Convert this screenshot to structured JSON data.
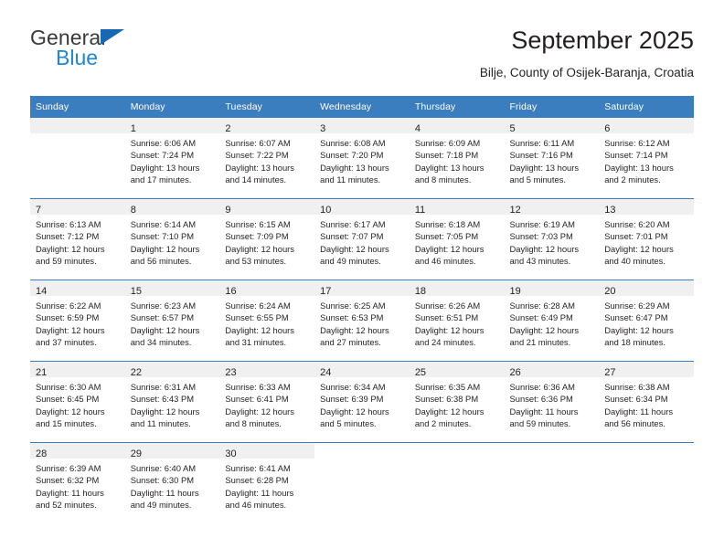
{
  "brand": {
    "name_top": "General",
    "name_bottom": "Blue",
    "triangle_color": "#1668b3",
    "blue_color": "#1f86d4"
  },
  "header": {
    "month_title": "September 2025",
    "location": "Bilje, County of Osijek-Baranja, Croatia"
  },
  "theme": {
    "header_row_color": "#3a7ebf",
    "daynum_band_color": "#f0f0f0",
    "text_color": "#231f20"
  },
  "calendar": {
    "weekday_headers": [
      "Sunday",
      "Monday",
      "Tuesday",
      "Wednesday",
      "Thursday",
      "Friday",
      "Saturday"
    ],
    "weeks": [
      [
        {
          "day": "",
          "lines": []
        },
        {
          "day": "1",
          "lines": [
            "Sunrise: 6:06 AM",
            "Sunset: 7:24 PM",
            "Daylight: 13 hours",
            "and 17 minutes."
          ]
        },
        {
          "day": "2",
          "lines": [
            "Sunrise: 6:07 AM",
            "Sunset: 7:22 PM",
            "Daylight: 13 hours",
            "and 14 minutes."
          ]
        },
        {
          "day": "3",
          "lines": [
            "Sunrise: 6:08 AM",
            "Sunset: 7:20 PM",
            "Daylight: 13 hours",
            "and 11 minutes."
          ]
        },
        {
          "day": "4",
          "lines": [
            "Sunrise: 6:09 AM",
            "Sunset: 7:18 PM",
            "Daylight: 13 hours",
            "and 8 minutes."
          ]
        },
        {
          "day": "5",
          "lines": [
            "Sunrise: 6:11 AM",
            "Sunset: 7:16 PM",
            "Daylight: 13 hours",
            "and 5 minutes."
          ]
        },
        {
          "day": "6",
          "lines": [
            "Sunrise: 6:12 AM",
            "Sunset: 7:14 PM",
            "Daylight: 13 hours",
            "and 2 minutes."
          ]
        }
      ],
      [
        {
          "day": "7",
          "lines": [
            "Sunrise: 6:13 AM",
            "Sunset: 7:12 PM",
            "Daylight: 12 hours",
            "and 59 minutes."
          ]
        },
        {
          "day": "8",
          "lines": [
            "Sunrise: 6:14 AM",
            "Sunset: 7:10 PM",
            "Daylight: 12 hours",
            "and 56 minutes."
          ]
        },
        {
          "day": "9",
          "lines": [
            "Sunrise: 6:15 AM",
            "Sunset: 7:09 PM",
            "Daylight: 12 hours",
            "and 53 minutes."
          ]
        },
        {
          "day": "10",
          "lines": [
            "Sunrise: 6:17 AM",
            "Sunset: 7:07 PM",
            "Daylight: 12 hours",
            "and 49 minutes."
          ]
        },
        {
          "day": "11",
          "lines": [
            "Sunrise: 6:18 AM",
            "Sunset: 7:05 PM",
            "Daylight: 12 hours",
            "and 46 minutes."
          ]
        },
        {
          "day": "12",
          "lines": [
            "Sunrise: 6:19 AM",
            "Sunset: 7:03 PM",
            "Daylight: 12 hours",
            "and 43 minutes."
          ]
        },
        {
          "day": "13",
          "lines": [
            "Sunrise: 6:20 AM",
            "Sunset: 7:01 PM",
            "Daylight: 12 hours",
            "and 40 minutes."
          ]
        }
      ],
      [
        {
          "day": "14",
          "lines": [
            "Sunrise: 6:22 AM",
            "Sunset: 6:59 PM",
            "Daylight: 12 hours",
            "and 37 minutes."
          ]
        },
        {
          "day": "15",
          "lines": [
            "Sunrise: 6:23 AM",
            "Sunset: 6:57 PM",
            "Daylight: 12 hours",
            "and 34 minutes."
          ]
        },
        {
          "day": "16",
          "lines": [
            "Sunrise: 6:24 AM",
            "Sunset: 6:55 PM",
            "Daylight: 12 hours",
            "and 31 minutes."
          ]
        },
        {
          "day": "17",
          "lines": [
            "Sunrise: 6:25 AM",
            "Sunset: 6:53 PM",
            "Daylight: 12 hours",
            "and 27 minutes."
          ]
        },
        {
          "day": "18",
          "lines": [
            "Sunrise: 6:26 AM",
            "Sunset: 6:51 PM",
            "Daylight: 12 hours",
            "and 24 minutes."
          ]
        },
        {
          "day": "19",
          "lines": [
            "Sunrise: 6:28 AM",
            "Sunset: 6:49 PM",
            "Daylight: 12 hours",
            "and 21 minutes."
          ]
        },
        {
          "day": "20",
          "lines": [
            "Sunrise: 6:29 AM",
            "Sunset: 6:47 PM",
            "Daylight: 12 hours",
            "and 18 minutes."
          ]
        }
      ],
      [
        {
          "day": "21",
          "lines": [
            "Sunrise: 6:30 AM",
            "Sunset: 6:45 PM",
            "Daylight: 12 hours",
            "and 15 minutes."
          ]
        },
        {
          "day": "22",
          "lines": [
            "Sunrise: 6:31 AM",
            "Sunset: 6:43 PM",
            "Daylight: 12 hours",
            "and 11 minutes."
          ]
        },
        {
          "day": "23",
          "lines": [
            "Sunrise: 6:33 AM",
            "Sunset: 6:41 PM",
            "Daylight: 12 hours",
            "and 8 minutes."
          ]
        },
        {
          "day": "24",
          "lines": [
            "Sunrise: 6:34 AM",
            "Sunset: 6:39 PM",
            "Daylight: 12 hours",
            "and 5 minutes."
          ]
        },
        {
          "day": "25",
          "lines": [
            "Sunrise: 6:35 AM",
            "Sunset: 6:38 PM",
            "Daylight: 12 hours",
            "and 2 minutes."
          ]
        },
        {
          "day": "26",
          "lines": [
            "Sunrise: 6:36 AM",
            "Sunset: 6:36 PM",
            "Daylight: 11 hours",
            "and 59 minutes."
          ]
        },
        {
          "day": "27",
          "lines": [
            "Sunrise: 6:38 AM",
            "Sunset: 6:34 PM",
            "Daylight: 11 hours",
            "and 56 minutes."
          ]
        }
      ],
      [
        {
          "day": "28",
          "lines": [
            "Sunrise: 6:39 AM",
            "Sunset: 6:32 PM",
            "Daylight: 11 hours",
            "and 52 minutes."
          ]
        },
        {
          "day": "29",
          "lines": [
            "Sunrise: 6:40 AM",
            "Sunset: 6:30 PM",
            "Daylight: 11 hours",
            "and 49 minutes."
          ]
        },
        {
          "day": "30",
          "lines": [
            "Sunrise: 6:41 AM",
            "Sunset: 6:28 PM",
            "Daylight: 11 hours",
            "and 46 minutes."
          ]
        },
        {
          "day": "",
          "lines": []
        },
        {
          "day": "",
          "lines": []
        },
        {
          "day": "",
          "lines": []
        },
        {
          "day": "",
          "lines": []
        }
      ]
    ]
  }
}
